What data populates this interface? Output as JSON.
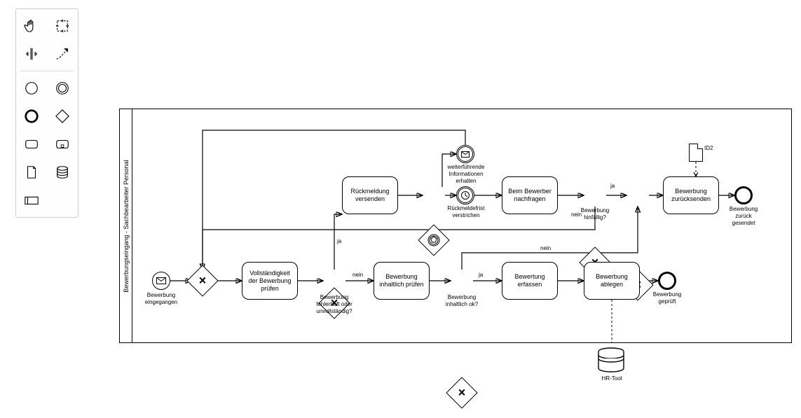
{
  "palette": {
    "tools": [
      {
        "name": "hand-tool",
        "label": "Hand"
      },
      {
        "name": "lasso-tool",
        "label": "Lasso"
      },
      {
        "name": "space-tool",
        "label": "Space"
      },
      {
        "name": "connect-tool",
        "label": "Connect"
      },
      {
        "name": "start-event-none",
        "label": "Start Event"
      },
      {
        "name": "intermediate-event-none",
        "label": "Intermediate Event"
      },
      {
        "name": "end-event-none",
        "label": "End Event"
      },
      {
        "name": "gateway-none",
        "label": "Gateway"
      },
      {
        "name": "task-none",
        "label": "Task"
      },
      {
        "name": "subprocess-expanded",
        "label": "Expanded Subprocess"
      },
      {
        "name": "data-object",
        "label": "Data Object"
      },
      {
        "name": "data-store",
        "label": "Data Store"
      },
      {
        "name": "participant",
        "label": "Participant"
      }
    ]
  },
  "lane": {
    "title": "Bewerbungseingang - Sachbearbeiter Personal"
  },
  "start_event": {
    "label": "Bewerbung eingegangen"
  },
  "gateway_g1_label": "",
  "tasks": {
    "t_check_complete": "Vollständigkeit der Bewerbung prüfen",
    "t_send_reply": "Rückmeldung versenden",
    "t_check_content": "Bewerbung inhaltlich prüfen",
    "t_ask_applicant": "Beim Bewerber nachfragen",
    "t_record_eval": "Bewertung erfassen",
    "t_file_app": "Bewerbung ablegen",
    "t_send_back": "Bewerbung zurücksenden"
  },
  "gateways": {
    "g2": "Bewerbung fehlerhaft oder unvollständig?",
    "g3": "Bewerbung inhaltlich ok?",
    "g4": "Bewerbung hinfällig?"
  },
  "events": {
    "info_received": "weiterführende Informationen erhalten",
    "deadline_passed": "Rückmeldefrist verstrichen"
  },
  "end_events": {
    "checked": "Bewerbung geprüft",
    "returned": "Bewerbung zurück gesendet"
  },
  "datastore": {
    "hr_tool": "HR-Tool"
  },
  "data_objects": {
    "id2": "ID2"
  },
  "edge_labels": {
    "g2_ja": "ja",
    "g2_nein": "nein",
    "g3_ja": "ja",
    "g3_nein": "nein",
    "g4_ja": "ja",
    "g4_nein": "nein"
  }
}
